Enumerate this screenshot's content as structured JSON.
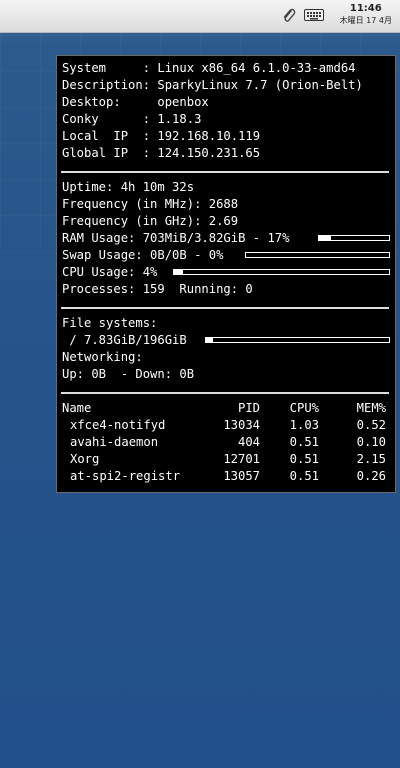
{
  "taskbar": {
    "icons": [
      "paperclip-icon",
      "keyboard-icon"
    ],
    "time": "11:46",
    "date": "木曜日 17 4月"
  },
  "conky": {
    "info": [
      "System     : Linux x86_64 6.1.0-33-amd64",
      "Description: SparkyLinux 7.7 (Orion-Belt)",
      "Desktop:     openbox",
      "Conky      : 1.18.3",
      "Local  IP  : 192.168.10.119",
      "Global IP  : 124.150.231.65"
    ],
    "stats": {
      "uptime": "Uptime: 4h 10m 32s",
      "freq_mhz": "Frequency (in MHz): 2688",
      "freq_ghz": "Frequency (in GHz): 2.69",
      "ram": "RAM Usage: 703MiB/3.82GiB - 17%",
      "ram_pct": 0.17,
      "swap": "Swap Usage: 0B/0B - 0%",
      "swap_pct": 0,
      "cpu": "CPU Usage: 4%",
      "cpu_pct": 0.04,
      "processes": "Processes: 159  Running: 0"
    },
    "fs": {
      "heading": "File systems:",
      "root": " / 7.83GiB/196GiB",
      "root_pct": 0.04,
      "net_heading": "Networking:",
      "net": "Up: 0B  - Down: 0B"
    },
    "procs": {
      "headers": {
        "name": "Name",
        "pid": "PID",
        "cpu": "CPU%",
        "mem": "MEM%"
      },
      "rows": [
        {
          "name": "xfce4-notifyd",
          "pid": "13034",
          "cpu": "1.03",
          "mem": "0.52"
        },
        {
          "name": "avahi-daemon",
          "pid": "404",
          "cpu": "0.51",
          "mem": "0.10"
        },
        {
          "name": "Xorg",
          "pid": "12701",
          "cpu": "0.51",
          "mem": "2.15"
        },
        {
          "name": "at-spi2-registr",
          "pid": "13057",
          "cpu": "0.51",
          "mem": "0.26"
        }
      ]
    }
  }
}
